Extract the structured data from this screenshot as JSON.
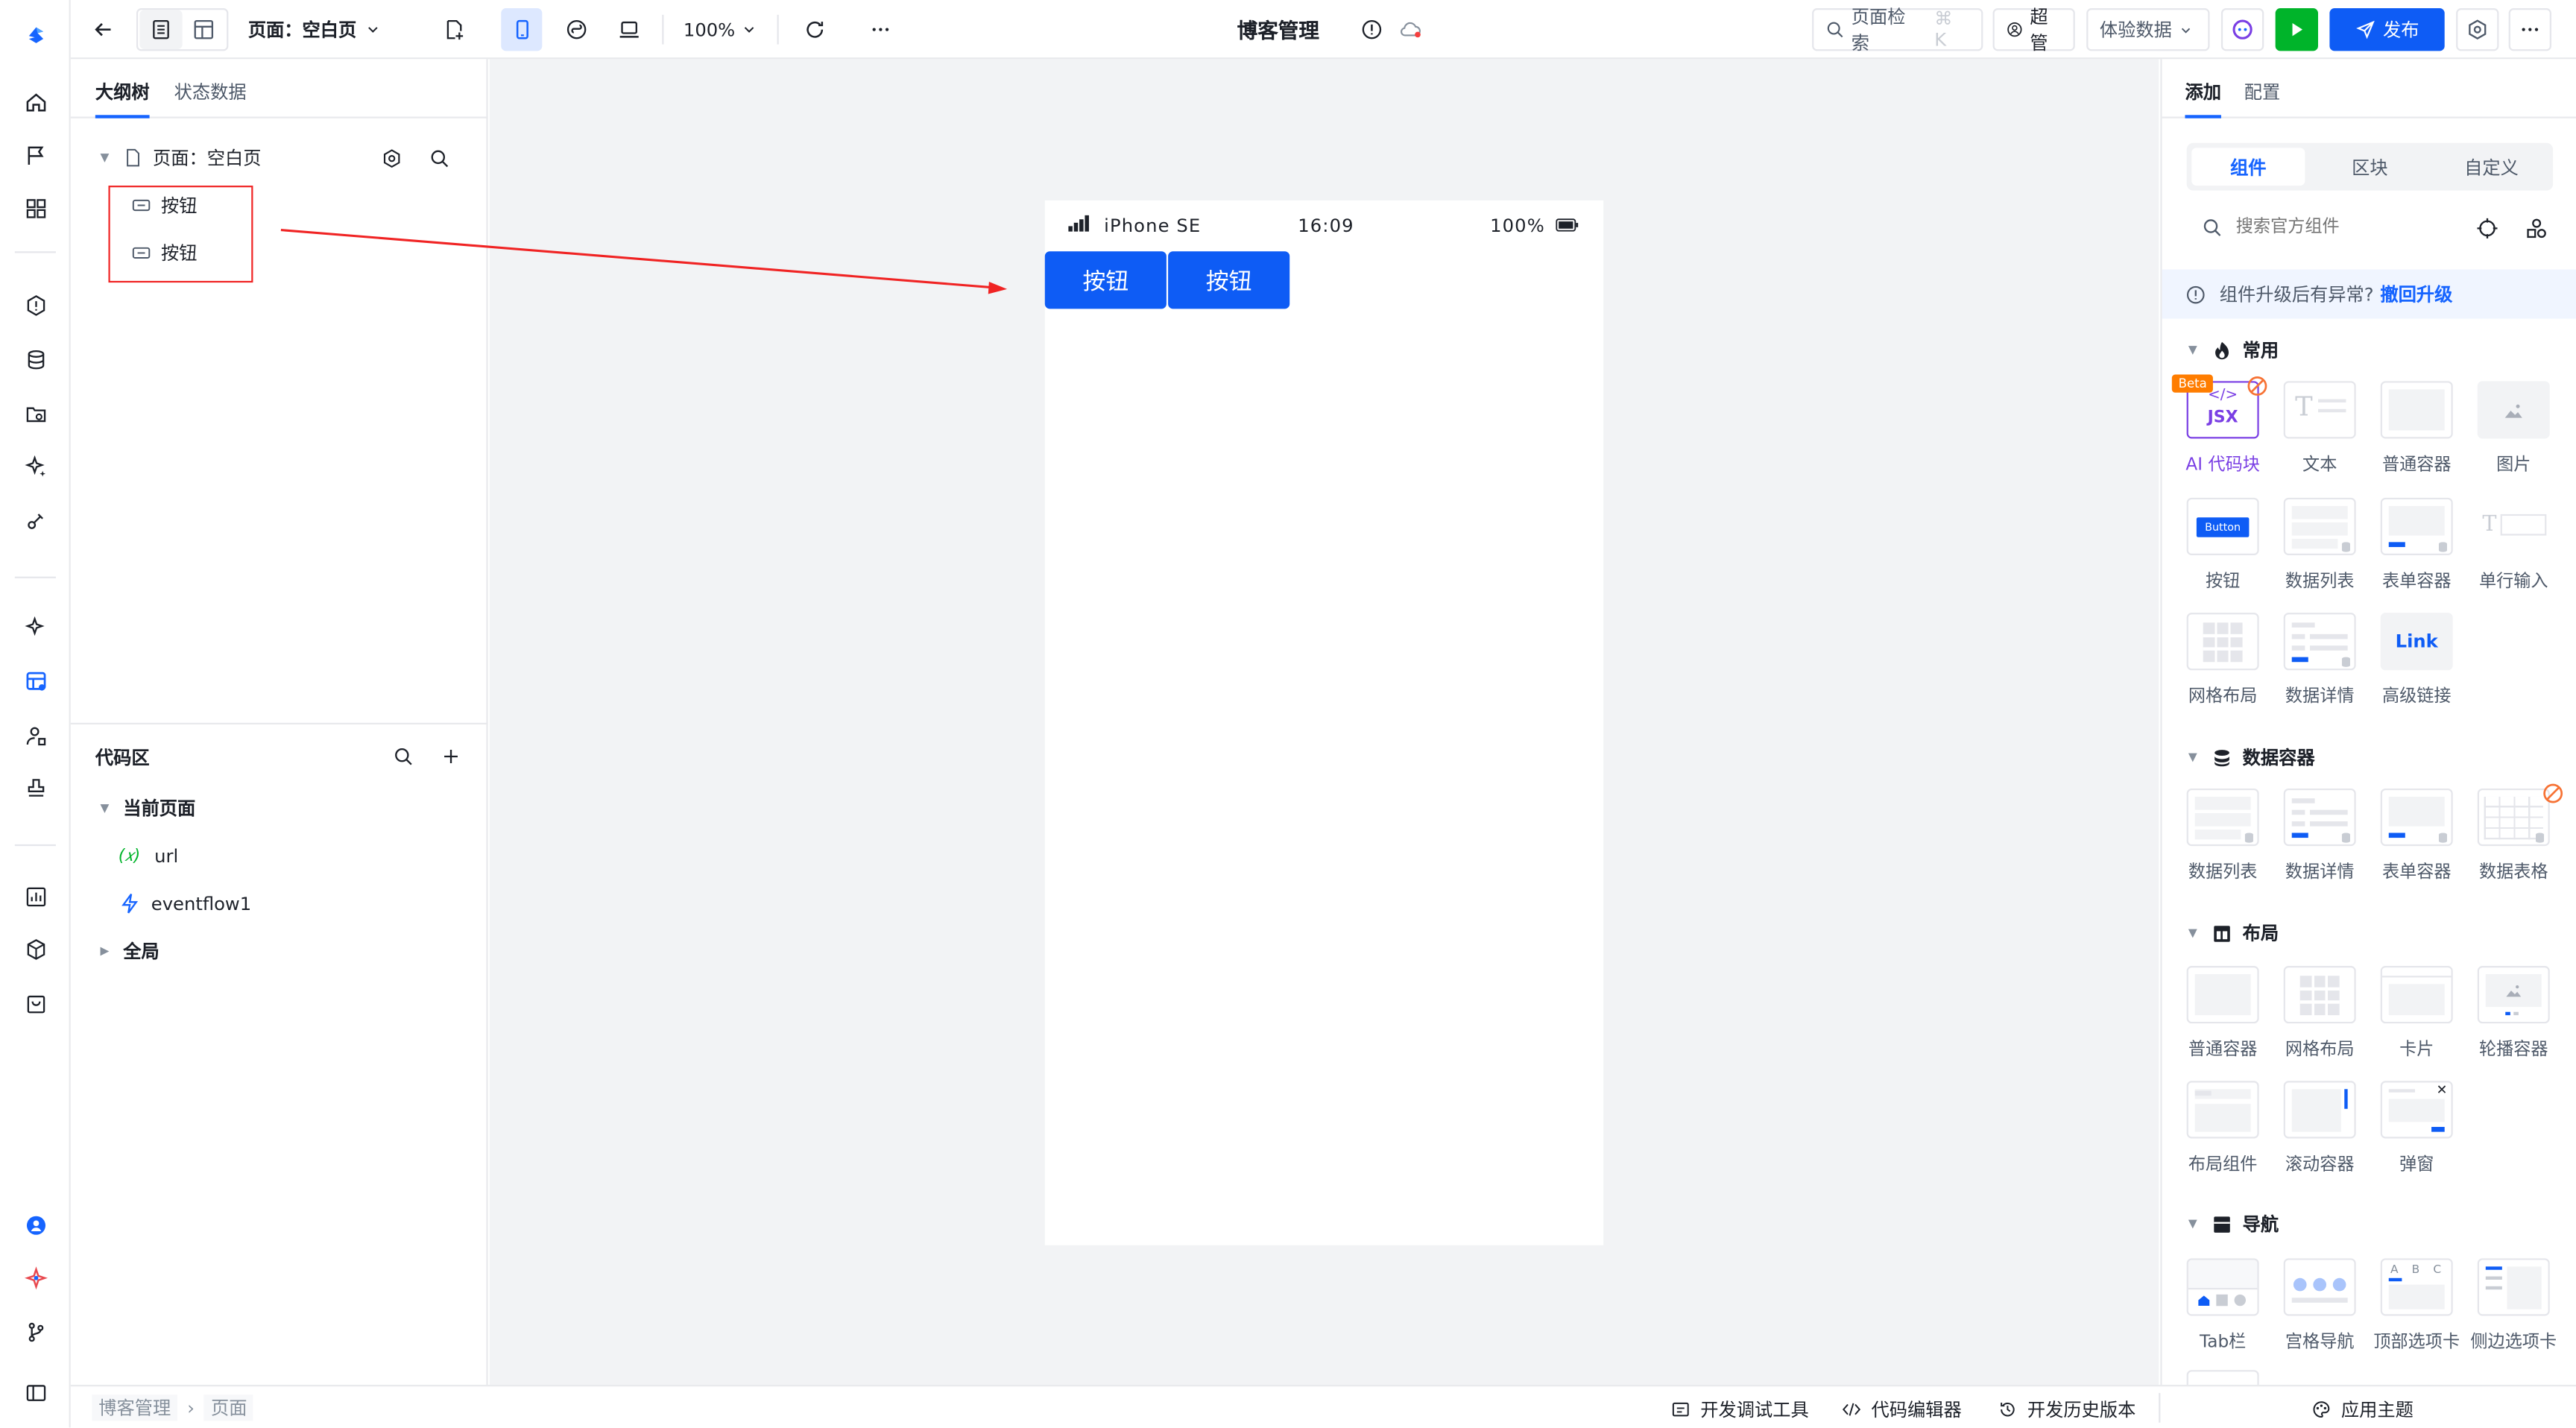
{
  "toolbar": {
    "page_label": "页面：空白页",
    "zoom": "100%",
    "app_title": "博客管理",
    "search_label": "页面检索",
    "search_shortcut": "⌘ K",
    "user": "超管",
    "experience_data": "体验数据",
    "publish": "发布"
  },
  "left_panel": {
    "tabs": [
      "大纲树",
      "状态数据"
    ],
    "tree_root": "页面：空白页",
    "tree_items": [
      "按钮",
      "按钮"
    ],
    "code_area_title": "代码区",
    "current_page": "当前页面",
    "vars": [
      {
        "label": "url"
      },
      {
        "label": "eventflow1"
      }
    ],
    "global": "全局"
  },
  "phone": {
    "carrier": "iPhone SE",
    "time": "16:09",
    "battery": "100%",
    "buttons": [
      "按钮",
      "按钮"
    ]
  },
  "right_panel": {
    "tabs": [
      "添加",
      "配置"
    ],
    "segments": [
      "组件",
      "区块",
      "自定义"
    ],
    "search_placeholder": "搜索官方组件",
    "notice": "组件升级后有异常?",
    "notice_action": "撤回升级",
    "sections": [
      {
        "title": "常用",
        "items": [
          "AI 代码块",
          "文本",
          "普通容器",
          "图片",
          "按钮",
          "数据列表",
          "表单容器",
          "单行输入",
          "网格布局",
          "数据详情",
          "高级链接"
        ]
      },
      {
        "title": "数据容器",
        "items": [
          "数据列表",
          "数据详情",
          "表单容器",
          "数据表格"
        ]
      },
      {
        "title": "布局",
        "items": [
          "普通容器",
          "网格布局",
          "卡片",
          "轮播容器",
          "布局组件",
          "滚动容器",
          "弹窗"
        ]
      },
      {
        "title": "导航",
        "items": [
          "Tab栏",
          "宫格导航",
          "顶部选项卡",
          "侧边选项卡"
        ]
      }
    ],
    "beta_badge": "Beta",
    "jsx_text": "JSX",
    "button_thumb_text": "Button",
    "link_thumb_text": "Link",
    "tab_thumb_letters": "A B C"
  },
  "bottom": {
    "breadcrumb": [
      "博客管理",
      "页面"
    ],
    "dev_tools": "开发调试工具",
    "code_editor": "代码编辑器",
    "history": "开发历史版本",
    "theme": "应用主题"
  },
  "colors": {
    "primary": "#0e5cf5",
    "annotation_red": "#f02323",
    "canvas_bg": "#f2f3f5"
  }
}
